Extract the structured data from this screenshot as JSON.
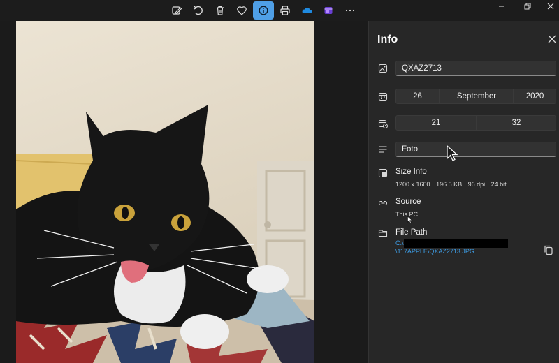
{
  "toolbar": {
    "buttons": [
      {
        "icon": "edit-image-icon"
      },
      {
        "icon": "rotate-icon"
      },
      {
        "icon": "delete-icon"
      },
      {
        "icon": "favorite-icon"
      },
      {
        "icon": "info-icon",
        "active": true
      },
      {
        "icon": "print-icon"
      },
      {
        "icon": "onedrive-icon"
      },
      {
        "icon": "clipchamp-icon"
      },
      {
        "icon": "more-icon"
      }
    ],
    "window_controls": [
      "minimize-icon",
      "restore-icon",
      "close-icon"
    ]
  },
  "photo": {
    "subject": "black-and-white cat"
  },
  "info_panel": {
    "title": "Info",
    "name_field": {
      "value": "QXAZ2713"
    },
    "date": {
      "day": "26",
      "month": "September",
      "year": "2020"
    },
    "time": {
      "hour": "21",
      "minute": "32"
    },
    "caption_field": {
      "value": "Foto"
    },
    "size_info": {
      "label": "Size Info",
      "dimensions": "1200 x 1600",
      "file_size": "196.5 KB",
      "dpi": "96 dpi",
      "bit_depth": "24 bit"
    },
    "source": {
      "label": "Source",
      "value": "This PC"
    },
    "file_path": {
      "label": "File Path",
      "line1": "C:\\",
      "line2": "\\117APPLE\\QXAZ2713.JPG"
    }
  },
  "colors": {
    "accent": "#4f9fe6",
    "link": "#3d9ee8",
    "panel_bg": "#272727",
    "app_bg": "#1c1c1c"
  }
}
